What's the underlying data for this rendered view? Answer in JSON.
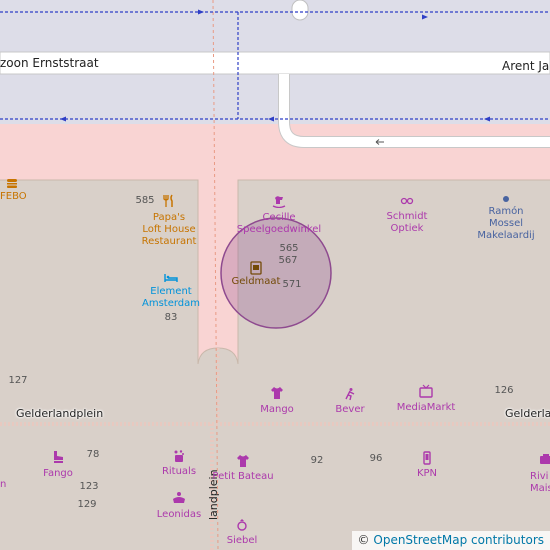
{
  "streets": {
    "ernststraat": "zoon Ernststraat",
    "arent": "Arent Jar",
    "gelderlandplein_left": "Gelderlandplein",
    "gelderlandplein_right": "Gelderlan",
    "landplein_vertical": "landplein"
  },
  "pois": {
    "febo": "FEBO",
    "papas": "Papa's\nLoft House\nRestaurant",
    "element": "Element\nAmsterdam",
    "cecille": "Cecille\nSpeelgoedwinkel",
    "schmidt": "Schmidt\nOptiek",
    "ramon": "Ramón\nMossel\nMakelaardij",
    "geldmaat": "Geldmaat",
    "mango": "Mango",
    "bever": "Bever",
    "mediamarkt": "MediaMarkt",
    "fango": "Fango",
    "rituals": "Rituals",
    "leonidas": "Leonidas",
    "petit_bateau": "Petit Bateau",
    "kpn": "KPN",
    "siebel": "Siebel",
    "riviera_1": "Rivi",
    "riviera_2": "Mais",
    "edge_n": "n"
  },
  "house_numbers": {
    "n585": "585",
    "n565": "565",
    "n567": "567",
    "n571": "571",
    "n83": "83",
    "n127": "127",
    "n126": "126",
    "n78": "78",
    "n123": "123",
    "n129": "129",
    "n92": "92",
    "n96": "96"
  },
  "icons": {
    "febo": "fast-food-icon",
    "papas": "restaurant-icon",
    "element": "hotel-icon",
    "cecille": "toy-horse-icon",
    "schmidt": "glasses-icon",
    "ramon": "office-dot-icon",
    "geldmaat": "atm-icon",
    "mango": "clothes-icon",
    "bever": "outdoor-icon",
    "mediamarkt": "electronics-icon",
    "fango": "shoe-icon",
    "rituals": "cosmetics-icon",
    "leonidas": "confectionery-icon",
    "petit_bateau": "clothes-icon",
    "kpn": "mobile-phone-icon",
    "siebel": "jewellery-icon"
  },
  "colors": {
    "land": "#d9d0c9",
    "road": "#ffffff",
    "pedestrian": "#dddde8",
    "restricted": "#f9d4d3",
    "circle": "#8e4a8f",
    "bus_route": "#2f3fc6"
  },
  "attribution": {
    "copyright": "©",
    "link": "OpenStreetMap contributors"
  }
}
